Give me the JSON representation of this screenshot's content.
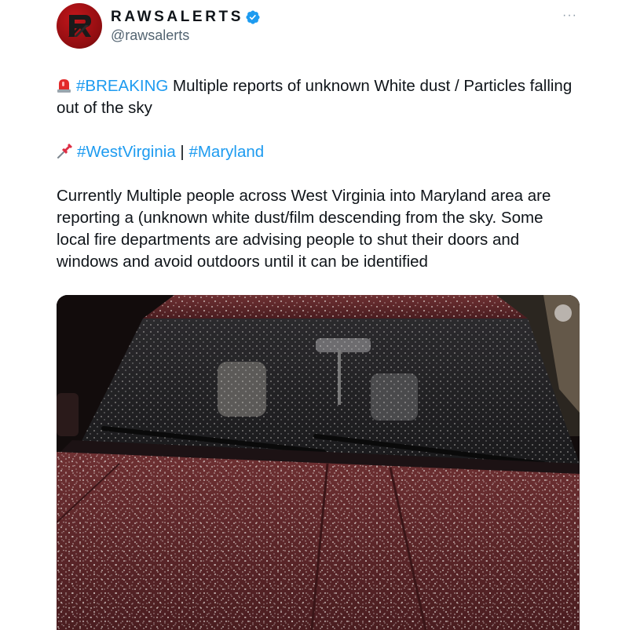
{
  "account": {
    "display_name": "RAWSALERTS",
    "handle": "@rawsalerts",
    "verified": true
  },
  "menu": {
    "more_label": "···"
  },
  "post": {
    "breaking_tag": "#BREAKING",
    "breaking_text": " Multiple reports of unknown White dust / Particles falling out of the sky",
    "tag_wv": "#WestVirginia",
    "tag_separator": " | ",
    "tag_md": "#Maryland",
    "body": "Currently Multiple people across West Virginia into Maryland area are reporting a (unknown white dust/film descending from the sky. Some local fire departments are advising people to shut their doors and windows and avoid outdoors until it can be identified"
  },
  "icons": {
    "siren": "police-siren-emoji",
    "pin": "pushpin-emoji",
    "verified": "verified-badge-icon",
    "media_overlay": "image-alt-icon"
  },
  "colors": {
    "link": "#1d9bf0",
    "text": "#0f1419",
    "secondary": "#536471",
    "avatar": "#a8121a"
  }
}
